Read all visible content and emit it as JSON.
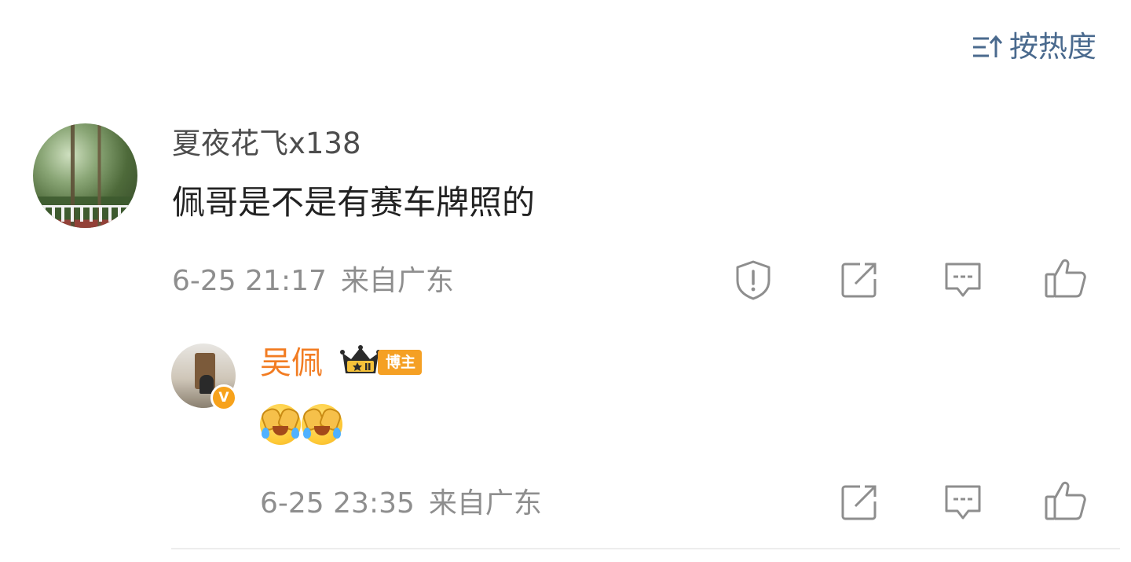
{
  "sort": {
    "icon": "sort-icon",
    "label": "按热度"
  },
  "comment": {
    "username": "夏夜花飞x138",
    "text": "佩哥是不是有赛车牌照的",
    "time": "6-25 21:17",
    "location": "来自广东",
    "actions": [
      "report-icon",
      "share-icon",
      "comment-icon",
      "like-icon"
    ]
  },
  "reply": {
    "username": "吴佩",
    "badge_label": "博主",
    "verified_label": "V",
    "emojis": [
      "laugh-cry-emoji",
      "laugh-cry-emoji"
    ],
    "time": "6-25 23:35",
    "location": "来自广东",
    "actions": [
      "share-icon",
      "comment-icon",
      "like-icon"
    ]
  },
  "colors": {
    "sort": "#4a6a8e",
    "username": "#4d4d4d",
    "reply_name": "#f27c22",
    "meta": "#8e8e8e",
    "badge": "#f5a024"
  }
}
